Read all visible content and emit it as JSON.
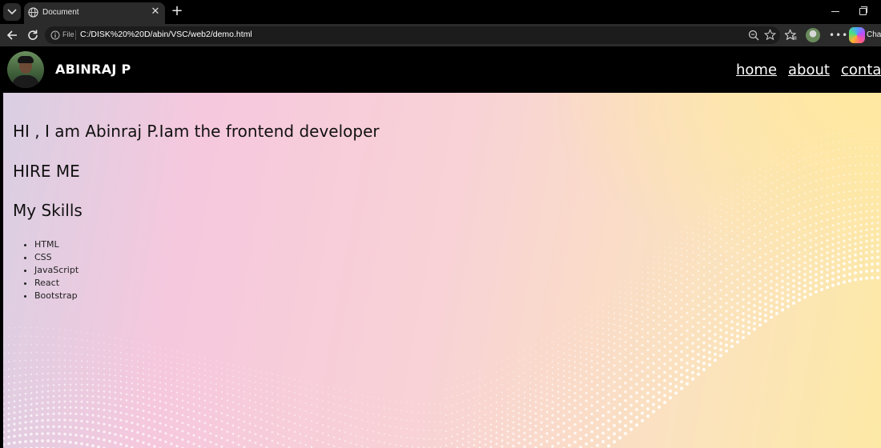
{
  "browser": {
    "tab_title": "Document",
    "address_label": "File",
    "url": "C:/DISK%20%20D/abin/VSC/web2/demo.html",
    "copilot_label": "Chat"
  },
  "site": {
    "name": "ABINRAJ P",
    "nav": [
      "home",
      "about",
      "contact"
    ]
  },
  "hero": {
    "intro": "HI , I am Abinraj P.Iam the frontend developer",
    "hire": "HIRE ME",
    "skills_heading": "My Skills",
    "skills": [
      "HTML",
      "CSS",
      "JavaScript",
      "React",
      "Bootstrap"
    ]
  },
  "colors": {
    "chrome_bg": "#000000",
    "toolbar_bg": "#2b2b2b",
    "header_bg": "#000000",
    "gradient_pink": "#f6c8dd",
    "gradient_yellow": "#fde9a6"
  }
}
